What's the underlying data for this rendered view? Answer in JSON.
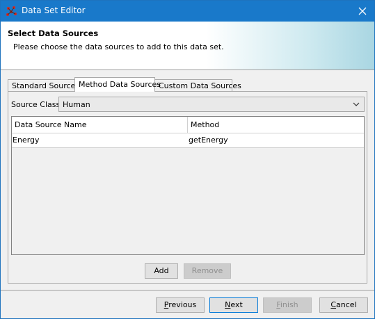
{
  "window": {
    "title": "Data Set Editor",
    "close_glyph": "✕"
  },
  "banner": {
    "heading": "Select Data Sources",
    "description": "Please choose the data sources to add to this data set."
  },
  "tabs": [
    {
      "label": "Standard Sources",
      "active": false
    },
    {
      "label": "Method Data Sources",
      "active": true
    },
    {
      "label": "Custom Data Sources",
      "active": false
    }
  ],
  "source_class": {
    "label": "Source Class:",
    "value": "Human"
  },
  "table": {
    "headers": [
      "Data Source Name",
      "Method"
    ],
    "rows": [
      [
        "Energy",
        "getEnergy"
      ]
    ]
  },
  "panel_buttons": {
    "add": "Add",
    "remove": "Remove"
  },
  "footer_buttons": {
    "previous": {
      "mnemonic": "P",
      "rest": "revious"
    },
    "next": {
      "mnemonic": "N",
      "rest": "ext"
    },
    "finish": {
      "mnemonic": "F",
      "rest": "inish"
    },
    "cancel": {
      "mnemonic": "C",
      "rest": "ancel"
    }
  },
  "icons": {
    "app": "molecule-icon",
    "combo_arrow": "chevron-down-icon",
    "close": "close-icon"
  },
  "colors": {
    "titlebar": "#1979ca",
    "focus_border": "#0078d7"
  }
}
